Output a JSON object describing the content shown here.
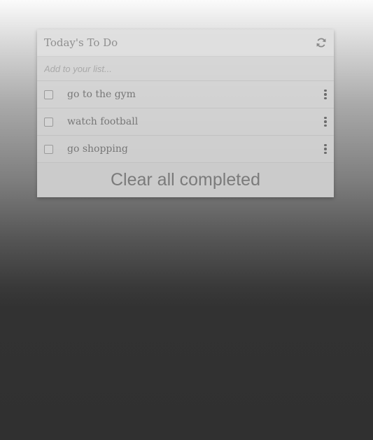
{
  "card": {
    "title": "Today's To Do",
    "refresh_icon": "refresh-icon"
  },
  "add": {
    "placeholder": "Add to your list..."
  },
  "todos": [
    {
      "label": "go to the gym",
      "checked": false,
      "menu_icon": "kebab-menu-icon"
    },
    {
      "label": "watch football",
      "checked": false,
      "menu_icon": "kebab-menu-icon"
    },
    {
      "label": "go shopping",
      "checked": false,
      "menu_icon": "kebab-menu-icon"
    }
  ],
  "footer": {
    "clear_label": "Clear all completed"
  }
}
